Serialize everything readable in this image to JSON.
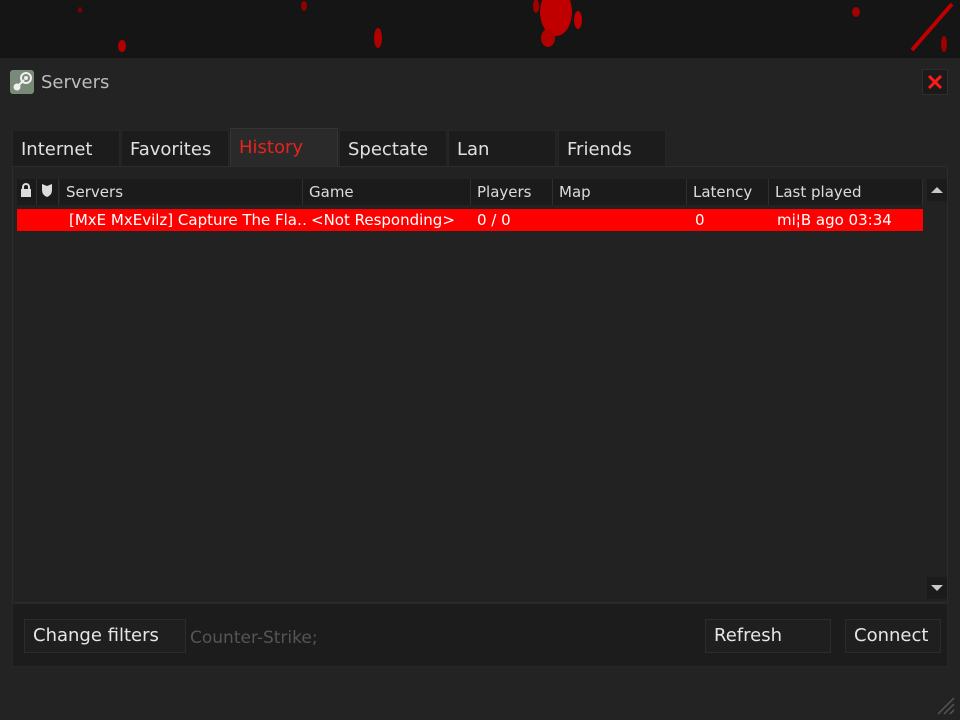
{
  "window": {
    "title": "Servers",
    "icon": "steam-icon",
    "close_icon": "close-icon"
  },
  "tabs": [
    {
      "label": "Internet",
      "active": false
    },
    {
      "label": "Favorites",
      "active": false
    },
    {
      "label": "History",
      "active": true
    },
    {
      "label": "Spectate",
      "active": false
    },
    {
      "label": "Lan",
      "active": false
    },
    {
      "label": "Friends",
      "active": false
    }
  ],
  "list": {
    "columns": {
      "lock_icon": "lock-icon",
      "secure_icon": "shield-icon",
      "servers": "Servers",
      "game": "Game",
      "players": "Players",
      "map": "Map",
      "latency": "Latency",
      "last_played": "Last played"
    },
    "rows": [
      {
        "server": "[MxE MxEvilz] Capture The Fla…",
        "game": "<Not Responding>",
        "players": "0 / 0",
        "map": "",
        "latency": "0",
        "last_played": "mi¦B ago 03:34",
        "selected": true
      }
    ]
  },
  "bottom": {
    "change_filters": "Change filters",
    "filter_summary": "Counter-Strike;",
    "refresh": "Refresh",
    "connect": "Connect"
  },
  "colors": {
    "accent": "#ff0000",
    "active_tab_text": "#e8221c",
    "background": "#232323"
  }
}
